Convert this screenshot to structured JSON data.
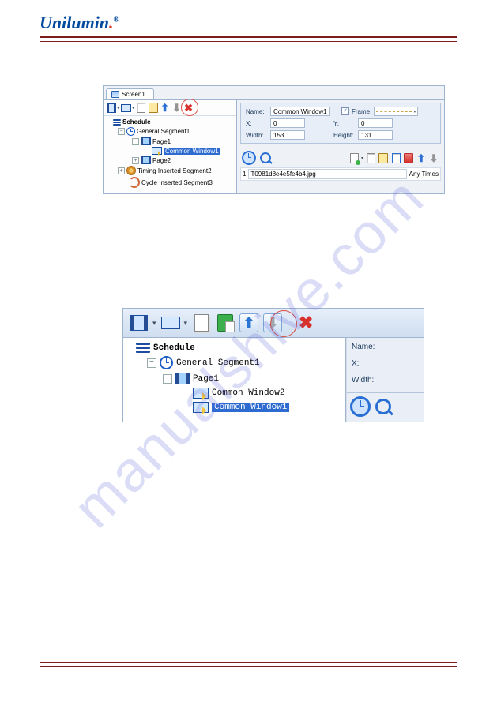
{
  "header": {
    "logo": "Unilumin"
  },
  "watermark": "manualshive.com",
  "shot1": {
    "tab": "Screen1",
    "tree": {
      "schedule": "Schedule",
      "gen_seg": "General Segment1",
      "page1": "Page1",
      "common_window1": "Common Window1",
      "page2": "Page2",
      "timing": "Timing Inserted Segment2",
      "cycle": "Cycle Inserted Segment3"
    },
    "props": {
      "name_label": "Name:",
      "name_value": "Common Window1",
      "frame_label": "Frame:",
      "frame_checked": "✓",
      "x_label": "X:",
      "x_value": "0",
      "y_label": "Y:",
      "y_value": "0",
      "w_label": "Width:",
      "w_value": "153",
      "h_label": "Height:",
      "h_value": "131"
    },
    "filerow": {
      "index": "1",
      "name": "T0981d8e4e5fe4b4.jpg",
      "times": "Any Times"
    }
  },
  "shot2": {
    "tree": {
      "schedule": "Schedule",
      "gen_seg": "General Segment1",
      "page1": "Page1",
      "cw2": "Common Window2",
      "cw1": "Common Window1"
    },
    "right": {
      "name": "Name:",
      "x": "X:",
      "width": "Width:"
    }
  }
}
